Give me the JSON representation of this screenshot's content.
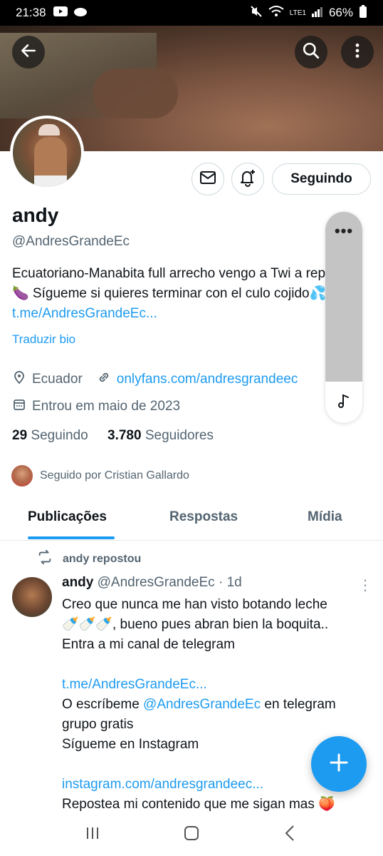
{
  "status_bar": {
    "time": "21:38",
    "battery": "66%",
    "network": "LTE1"
  },
  "profile": {
    "name": "andy",
    "handle": "@AndresGrandeEc",
    "bio_text": "Ecuatoriano-Manabita full arrecho vengo a Twi a repartir 🍆 Sígueme si quieres terminar con el culo cojido💦🍑 ",
    "bio_link": "t.me/AndresGrandeEc...",
    "translate_bio": "Traduzir bio",
    "location": "Ecuador",
    "website": "onlyfans.com/andresgrandeec",
    "joined": "Entrou em maio de 2023",
    "following_count": "29",
    "following_label": "Seguindo",
    "followers_count": "3.780",
    "followers_label": "Seguidores",
    "followed_by": "Seguido por Cristian Gallardo",
    "follow_button": "Seguindo"
  },
  "tabs": [
    "Publicações",
    "Respostas",
    "Mídia"
  ],
  "post": {
    "repost_label": "andy repostou",
    "author_name": "andy",
    "author_handle": "@AndresGrandeEc",
    "time": "· 1d",
    "line1": "Creo que nunca me han visto botando leche",
    "line2": "🍼🍼🍼, bueno pues abran bien la boquita..",
    "line3": "Entra a mi canal de telegram",
    "link1": "t.me/AndresGrandeEc...",
    "line4_pre": " O escríbeme ",
    "line4_mention": "@AndresGrandeEc",
    "line4_post": " en telegram",
    "line5": "grupo gratis",
    "line6": "Sígueme en Instagram",
    "link2": "instagram.com/andresgrandeec...",
    "line7": "Repostea mi contenido que me sigan mas 🍑"
  },
  "colors": {
    "accent": "#1d9bf0",
    "text": "#0f1419",
    "secondary": "#536471"
  }
}
